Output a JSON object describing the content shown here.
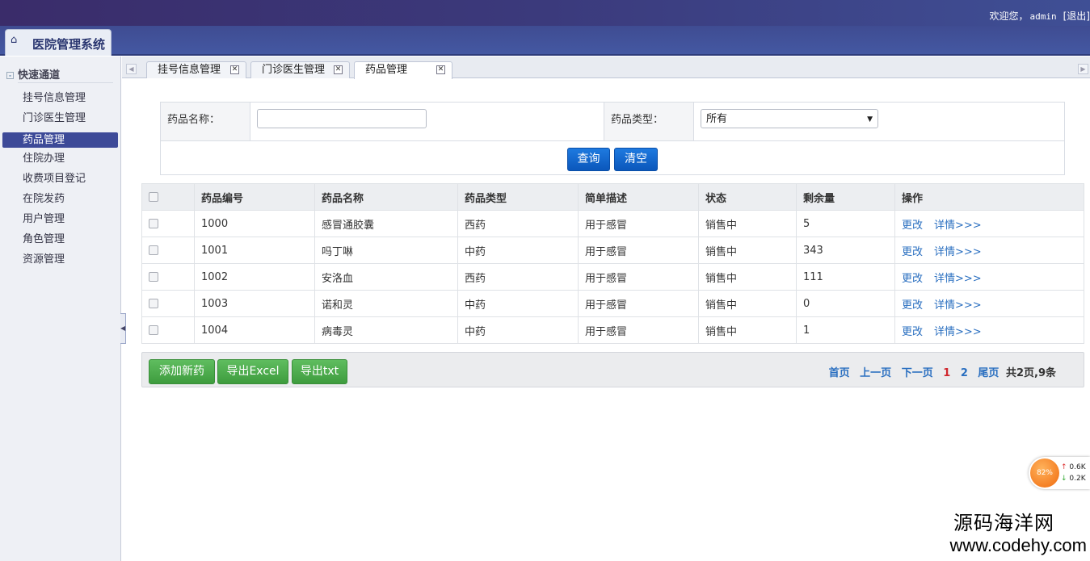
{
  "top": {
    "welcome": "欢迎您，",
    "user": "admin",
    "logout": "[退出]"
  },
  "brand": {
    "title": "医院管理系统"
  },
  "sidebar": {
    "heading": "快速通道",
    "items": [
      {
        "label": "挂号信息管理"
      },
      {
        "label": "门诊医生管理"
      },
      {
        "label": "药品管理",
        "active": true
      },
      {
        "label": "住院办理"
      },
      {
        "label": "收费项目登记"
      },
      {
        "label": "在院发药"
      },
      {
        "label": "用户管理"
      },
      {
        "label": "角色管理"
      },
      {
        "label": "资源管理"
      }
    ]
  },
  "tabs": [
    {
      "label": "挂号信息管理"
    },
    {
      "label": "门诊医生管理"
    },
    {
      "label": "药品管理",
      "active": true
    }
  ],
  "search": {
    "name_label": "药品名称：",
    "name_value": "",
    "type_label": "药品类型：",
    "type_value": "所有",
    "query_button": "查询",
    "clear_button": "清空"
  },
  "table": {
    "headers": [
      "药品编号",
      "药品名称",
      "药品类型",
      "简单描述",
      "状态",
      "剩余量",
      "操作"
    ],
    "rows": [
      {
        "id": "1000",
        "name": "感冒通胶囊",
        "type": "西药",
        "desc": "用于感冒",
        "status": "销售中",
        "remain": "5"
      },
      {
        "id": "1001",
        "name": "吗丁啉",
        "type": "中药",
        "desc": "用于感冒",
        "status": "销售中",
        "remain": "343"
      },
      {
        "id": "1002",
        "name": "安洛血",
        "type": "西药",
        "desc": "用于感冒",
        "status": "销售中",
        "remain": "111"
      },
      {
        "id": "1003",
        "name": "诺和灵",
        "type": "中药",
        "desc": "用于感冒",
        "status": "销售中",
        "remain": "0"
      },
      {
        "id": "1004",
        "name": "病毒灵",
        "type": "中药",
        "desc": "用于感冒",
        "status": "销售中",
        "remain": "1"
      }
    ],
    "edit_label": "更改",
    "detail_label": "详情>>>"
  },
  "actions": {
    "add": "添加新药",
    "export_excel": "导出Excel",
    "export_txt": "导出txt"
  },
  "pager": {
    "first": "首页",
    "prev": "上一页",
    "next": "下一页",
    "page1": "1",
    "page2": "2",
    "last": "尾页",
    "total": "共2页,9条"
  },
  "net_widget": {
    "percent": "82%",
    "up": "0.6K",
    "down": "0.2K"
  },
  "watermark": {
    "line1": "源码海洋网",
    "line2": "www.codehy.com"
  },
  "colors": {
    "accent": "#3d4a98",
    "link": "#2a6fc0",
    "primary_button": "#0b57bb",
    "success_button": "#3e9c3e",
    "current_page": "#d0262d"
  }
}
